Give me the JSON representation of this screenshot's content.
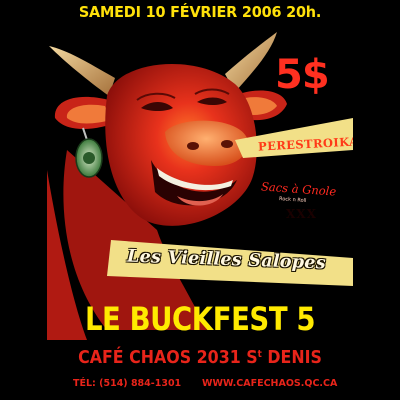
{
  "poster": {
    "date_line": "SAMEDI 10 FÉVRIER 2006 20h.",
    "price": "5$",
    "bands": {
      "band1": "PERESTROIKA",
      "band2": "Sacs à Gnole",
      "band2_small": "Rock n Roll",
      "band2_mark": "XXX",
      "band3": "Les Vieilles Salopes"
    },
    "title": "LE BUCKFEST 5",
    "venue_main": "CAFÉ CHAOS 2031 S",
    "venue_sup": "t",
    "venue_end": " DENIS",
    "phone": "TÉL: (514) 884-1301",
    "website": "WWW.CAFECHAOS.QC.CA"
  },
  "colors": {
    "background": "#000000",
    "cow_red": "#d8241c",
    "yellow": "#ffe10a",
    "venue_red": "#e8241a"
  }
}
